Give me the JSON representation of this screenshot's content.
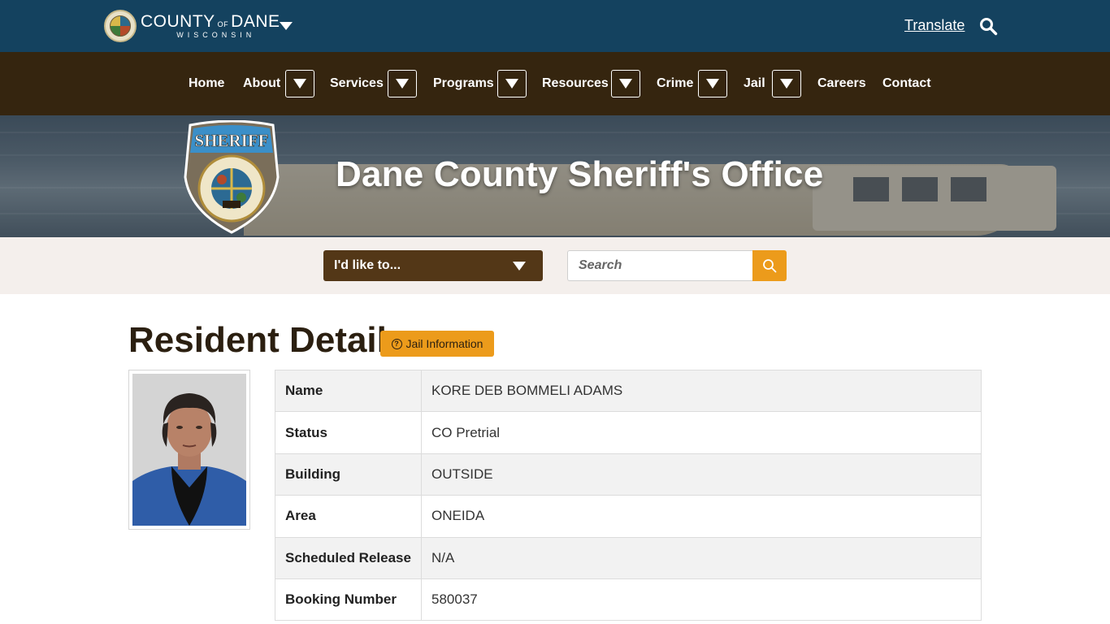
{
  "header": {
    "logo": {
      "main_left": "COUNTY",
      "main_of": "OF",
      "main_right": "DANE",
      "sub": "WISCONSIN"
    },
    "translate_label": "Translate",
    "colors": {
      "topbar": "#14425f",
      "navbar": "#35250f",
      "accent": "#ec9b1b",
      "select": "#533717"
    }
  },
  "nav": {
    "items": [
      {
        "label": "Home",
        "has_dropdown": false
      },
      {
        "label": "About",
        "has_dropdown": true
      },
      {
        "label": "Services",
        "has_dropdown": true
      },
      {
        "label": "Programs",
        "has_dropdown": true
      },
      {
        "label": "Resources",
        "has_dropdown": true
      },
      {
        "label": "Crime",
        "has_dropdown": true
      },
      {
        "label": "Jail",
        "has_dropdown": true
      },
      {
        "label": "Careers",
        "has_dropdown": false
      },
      {
        "label": "Contact",
        "has_dropdown": false
      }
    ]
  },
  "hero": {
    "title": "Dane County Sheriff's Office",
    "badge": {
      "top_text": "SHERIFF",
      "ring_top": "COUNTY of DANE",
      "ring_bottom": "WISCONSIN",
      "year": "1836"
    }
  },
  "search_band": {
    "like_label": "I'd like to...",
    "search_placeholder": "Search"
  },
  "main": {
    "page_title": "Resident Detail",
    "jail_info_label": "Jail Information",
    "details": [
      {
        "label": "Name",
        "value": "KORE DEB BOMMELI ADAMS"
      },
      {
        "label": "Status",
        "value": "CO Pretrial"
      },
      {
        "label": "Building",
        "value": "OUTSIDE"
      },
      {
        "label": "Area",
        "value": "ONEIDA"
      },
      {
        "label": "Scheduled Release",
        "value": "N/A"
      },
      {
        "label": "Booking Number",
        "value": "580037"
      }
    ]
  }
}
